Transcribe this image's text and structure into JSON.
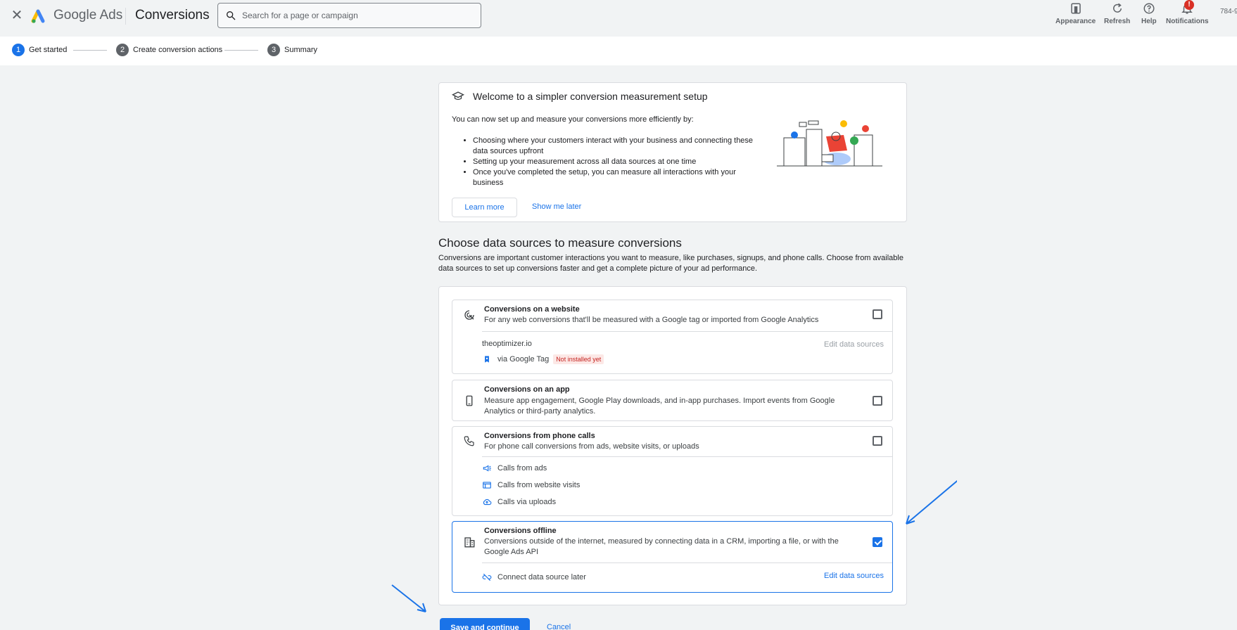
{
  "header": {
    "brand": "Google Ads",
    "page_title": "Conversions",
    "search_placeholder": "Search for a page or campaign",
    "buttons": {
      "appearance": "Appearance",
      "refresh": "Refresh",
      "help": "Help",
      "notifications": "Notifications"
    },
    "notification_badge": "!",
    "account_id": "784-9"
  },
  "stepper": {
    "steps": [
      {
        "num": "1",
        "label": "Get started",
        "active": true
      },
      {
        "num": "2",
        "label": "Create conversion actions",
        "active": false
      },
      {
        "num": "3",
        "label": "Summary",
        "active": false
      }
    ]
  },
  "welcome": {
    "title": "Welcome to a simpler conversion measurement setup",
    "intro": "You can now set up and measure your conversions more efficiently by:",
    "bullets": [
      "Choosing where your customers interact with your business and connecting these data sources upfront",
      "Setting up your measurement across all data sources at one time",
      "Once you've completed the setup, you can measure all interactions with your business"
    ],
    "learn_more": "Learn more",
    "show_me_later": "Show me later"
  },
  "section": {
    "title": "Choose data sources to measure conversions",
    "description": "Conversions are important customer interactions you want to measure, like purchases, signups, and phone calls. Choose from available data sources to set up conversions faster and get a complete picture of your ad performance."
  },
  "sources": {
    "website": {
      "title": "Conversions on a website",
      "description": "For any web conversions that'll be measured with a Google tag or imported from Google Analytics",
      "checked": false,
      "domain": "theoptimizer.io",
      "edit_label": "Edit data sources",
      "via": "via Google Tag",
      "status_badge": "Not installed yet"
    },
    "app": {
      "title": "Conversions on an app",
      "description": "Measure app engagement, Google Play downloads, and in-app purchases. Import events from Google Analytics or third-party analytics.",
      "checked": false
    },
    "phone": {
      "title": "Conversions from phone calls",
      "description": "For phone call conversions from ads, website visits, or uploads",
      "checked": false,
      "items": [
        "Calls from ads",
        "Calls from website visits",
        "Calls via uploads"
      ]
    },
    "offline": {
      "title": "Conversions offline",
      "description": "Conversions outside of the internet, measured by connecting data in a CRM, importing a file, or with the Google Ads API",
      "checked": true,
      "connect_later": "Connect data source later",
      "edit_label": "Edit data sources"
    }
  },
  "actions": {
    "save": "Save and continue",
    "cancel": "Cancel"
  },
  "colors": {
    "accent": "#1a73e8",
    "annotation_arrow": "#1a73e8",
    "error_badge": "#c5221f"
  }
}
